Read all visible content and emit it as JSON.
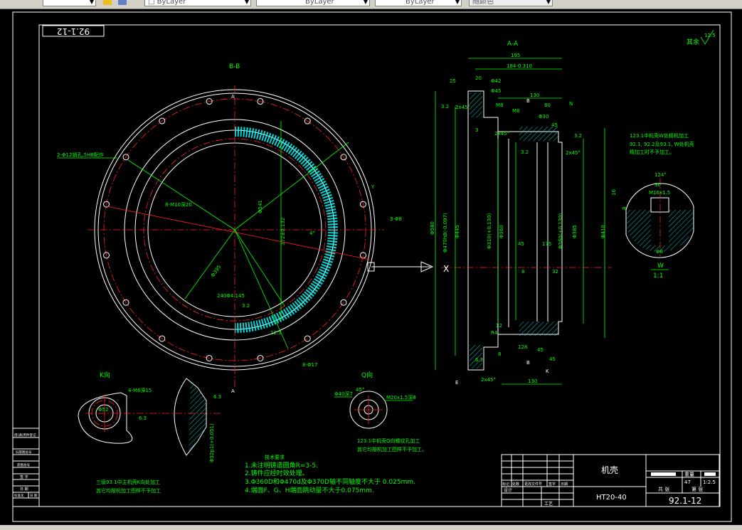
{
  "toolbar": {
    "layer_color": "ByLayer",
    "linetype": "ByLayer",
    "lineweight": "ByLayer",
    "plot_style": "随颜色"
  },
  "drawing": {
    "sheet_code_rotated": "92.1-12",
    "roughness_other": "其余",
    "roughness_other_value": "12.5",
    "views": {
      "bb": "B-B",
      "aa": "A-A",
      "k": "K向",
      "q": "Q向",
      "w": "W",
      "w_scale": "1:1",
      "section_a_top": "A",
      "section_a_bottom": "A",
      "x": "X",
      "y": "Y",
      "e": "E",
      "k_mark": "K",
      "b_mark": "B",
      "n_mark": "N"
    },
    "bb_dims": {
      "pin_holes": "2-Φ12销孔,5H8配作",
      "threads": "8-M10深20",
      "dia_541": "Φ541",
      "holes_3": "3-Φ8",
      "dia_395": "Φ395",
      "dim_372": "372±0.132",
      "dim_240": "240Φ4.145",
      "rough_12_5": "12.5",
      "rough_3_2": "3.2",
      "rough_6_3": "6.3",
      "holes_8": "8-Φ17",
      "angle": "4°"
    },
    "aa_dims": {
      "d195": "195",
      "d184": "184-0.310",
      "d20": "20",
      "phi42": "Φ42",
      "r25": "25",
      "r32": "3.2",
      "ch1": "2x45°",
      "phi45": "Φ45",
      "d130": "130",
      "m8a": "M8",
      "m8b": "M8",
      "d80": "80",
      "phi30": "Φ30",
      "d45": "45",
      "d3": "3",
      "ch2": "2x45°",
      "ch3": "2x45°",
      "r32b": "3.2",
      "phi580": "Φ580",
      "phi470": "Φ470h8(-0.097)",
      "phi445": "Φ445",
      "phi310": "Φ310(+0.130)",
      "phi360": "Φ360",
      "phi385": "Φ385",
      "phi410": "Φ410",
      "phi360b": "Φ360(+0.130)",
      "d45b": "45",
      "d175": "175",
      "d8": "8",
      "d32": "32",
      "d12": "12",
      "r4": "R4",
      "d45c": "45",
      "d45d": "45",
      "d130b": "130",
      "d128": "128",
      "d8b": "8",
      "ch4": "2x45°",
      "r63": "6.3"
    },
    "w_dims": {
      "d124": "124°",
      "d30": "30",
      "m16": "M16x1.5",
      "phi8": "Φ8",
      "d16": "16",
      "d8": "8"
    },
    "k_dims": {
      "holes": "4-M6深15",
      "bolt_circle": "Φ52",
      "rough": "6.3",
      "rough2": "6.3",
      "bore": "Φ32p1(+0.051)"
    },
    "q_dims": {
      "dia": "Φ40深7",
      "thread": "M20x1.5深8",
      "angle": "45°"
    },
    "notes_w": [
      "123.1中机壳W处精机加工",
      "92.1, 92.2及93.1, W处机壳",
      "精加工时不予加工。"
    ],
    "notes_k": [
      "三级93.1中主机壳K向处加工",
      "其它均按机加工图样不予加工"
    ],
    "notes_q": [
      "123.1中机壳Q向螺纹孔加工",
      "其它均按机加工图样不予加工。"
    ],
    "tech_requirements": {
      "title": "技术要求",
      "items": [
        "1.未注明铸造圆角R=3-5.",
        "2.铸件应经时效处理。",
        "3.Φ360D和Φ470d及Φ370D轴不同轴度不大于 0.025mm.",
        "4.端面F、G、H端面跳动量不大于0.075mm."
      ]
    }
  },
  "title_block": {
    "part_name": "机壳",
    "material": "HT20-40",
    "drawing_no": "92.1-12",
    "weight_label": "重量",
    "scale_label": "比例",
    "weight": "47",
    "scale": "1:2.5",
    "sheets_total": "共 张",
    "sheet_no": "第 张",
    "rev_headers": [
      "标记",
      "处数",
      "更改文件号",
      "签字",
      "日期"
    ],
    "design": "设计",
    "process": "工艺"
  },
  "side_block": {
    "rows": [
      "借(通)用件登记",
      "旧底图总号",
      "底图总号",
      "签 字",
      "日 期",
      "标准化",
      "日 期"
    ]
  },
  "colors": {
    "background": "#000000",
    "outline": "#ffffff",
    "dimension": "#00ff00",
    "centerline": "#ff2020",
    "hatch": "#00ffff"
  }
}
